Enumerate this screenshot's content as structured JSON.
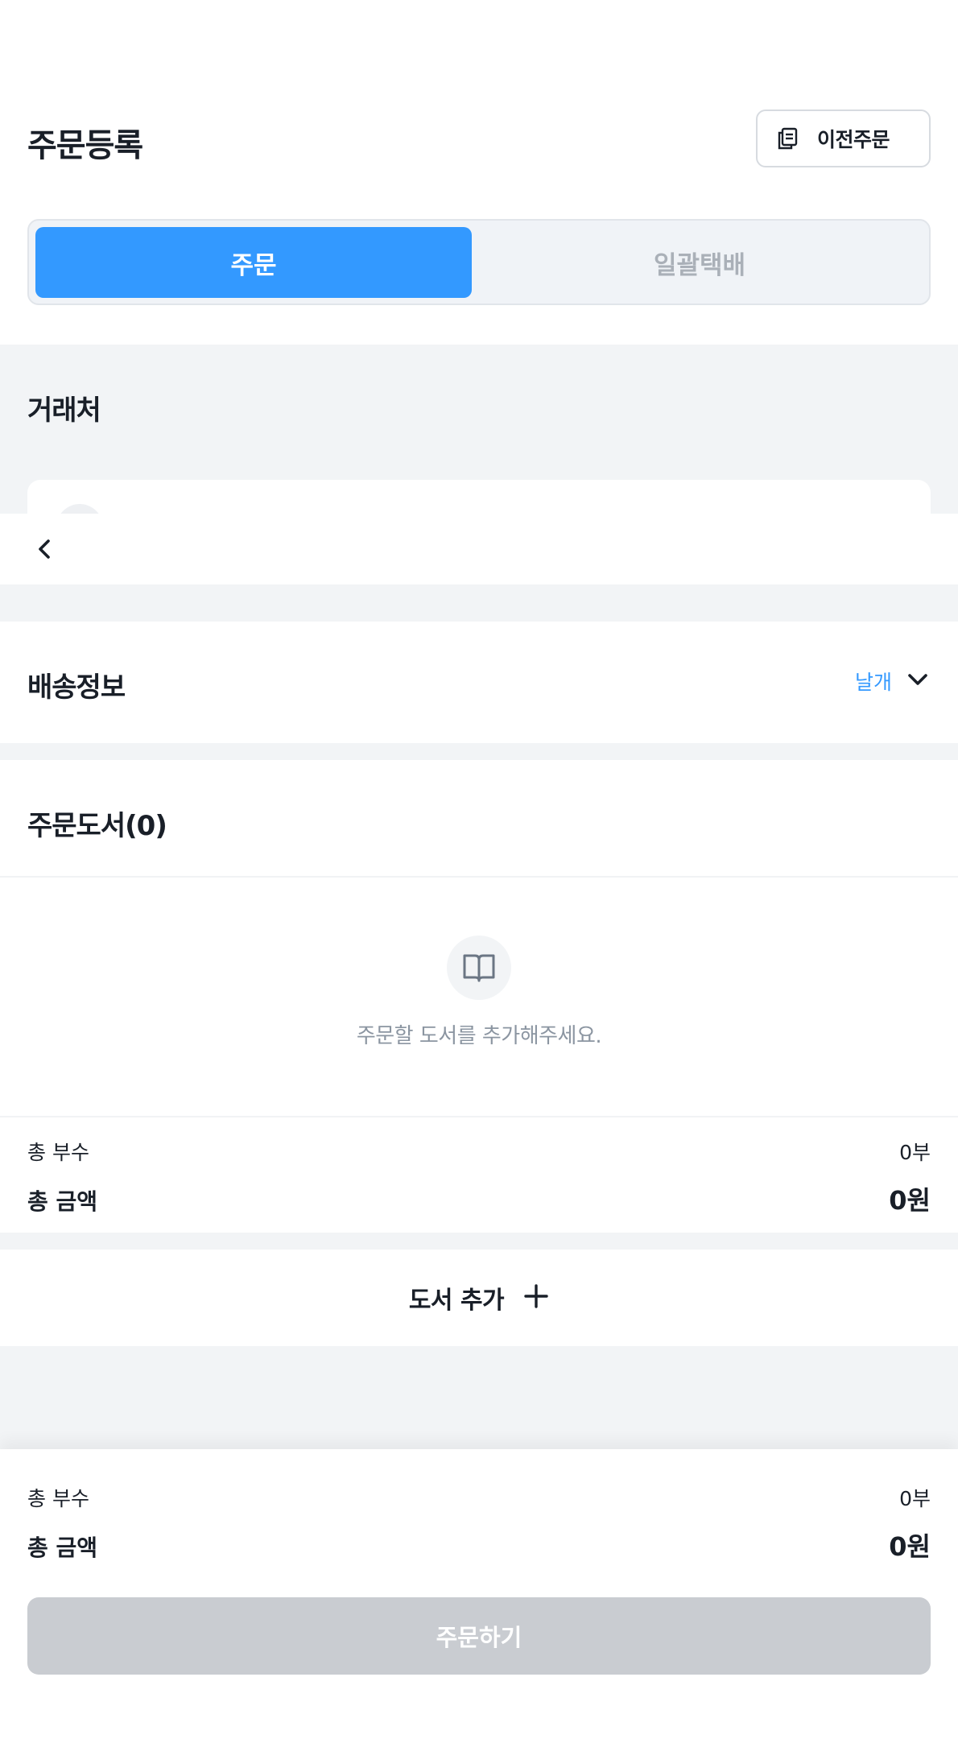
{
  "header": {
    "title": "주문등록",
    "prev_order_label": "이전주문"
  },
  "tabs": [
    {
      "label": "주문",
      "active": true
    },
    {
      "label": "일괄택배",
      "active": false
    }
  ],
  "partner": {
    "title": "거래처"
  },
  "delivery": {
    "title": "배송정보",
    "toggle_label": "날개"
  },
  "books": {
    "title": "주문도서(0)",
    "empty_message": "주문할 도서를 추가해주세요.",
    "total_count_label": "총 부수",
    "total_count_value": "0부",
    "total_amount_label": "총 금액",
    "total_amount_value": "0원"
  },
  "add_book": {
    "label": "도서 추가"
  },
  "footer": {
    "total_count_label": "총 부수",
    "total_count_value": "0부",
    "total_amount_label": "총 금액",
    "total_amount_value": "0원",
    "order_button_label": "주문하기"
  },
  "colors": {
    "accent": "#3399ff",
    "disabled_button": "#c9ccd1",
    "background": "#f2f4f6"
  },
  "icons": [
    "copy-icon",
    "back-arrow-icon",
    "chevron-down-icon",
    "book-icon",
    "plus-icon"
  ]
}
